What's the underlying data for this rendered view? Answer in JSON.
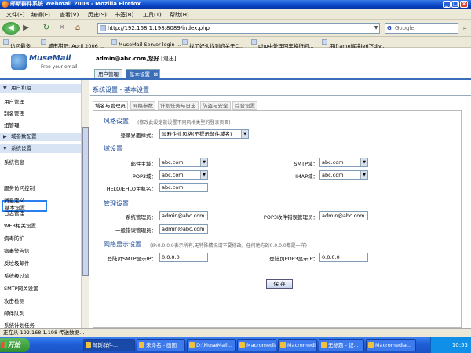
{
  "window": {
    "title": "邮斯群件系统 Webmail 2008 - Mozilla Firefox"
  },
  "menu": [
    "文件(F)",
    "编辑(E)",
    "查看(V)",
    "历史(S)",
    "书签(B)",
    "工具(T)",
    "帮助(H)"
  ],
  "nav": {
    "url": "http://192.168.1.198:8089/index.php",
    "search_placeholder": "Google",
    "search_engine": "G"
  },
  "bookmarks": [
    "访问最多",
    "城市甜阳: April 2006 ...",
    "MuseMail Server login ...",
    "找了好久找到的关于C...",
    "php中处理回车换行问...",
    "用iframe解决ie6下div..."
  ],
  "app": {
    "logo_name": "MuseMail",
    "logo_tag": "Free your email",
    "user": "admin@abc.com,您好",
    "logout": "[退出]",
    "tabs": [
      "用户管理",
      "基本设置"
    ],
    "tab_close": "⊠"
  },
  "sidebar": {
    "sections": [
      "用户和组",
      "域参数配置",
      "系统设置"
    ],
    "group1": [
      "用户管理",
      "别名管理",
      "组管理"
    ],
    "group3": [
      "系统信息",
      "基本设置",
      "服务访问控制",
      "消息定义",
      "日志管理",
      "WEB相关设置",
      "病毒防护",
      "病毒警告信",
      "反垃圾邮件",
      "系统级过滤",
      "SMTP网关设置",
      "攻击检测",
      "邮件队列",
      "系统计划任务"
    ]
  },
  "main": {
    "title": "系统设置 - 基本设置",
    "subtabs": [
      "域名与管理员",
      "网络参数",
      "计划任务与日志",
      "防盗与安全",
      "综合设置"
    ],
    "style_section": "风格设置",
    "style_note": "(修改此设定能设置不同风格类型的登录页面)",
    "login_style_label": "登录界面样式：",
    "login_style_value": "淡雅企业风格(不提示邮件域名)",
    "domain_section": "域设置",
    "main_domain_label": "邮件主域：",
    "main_domain_value": "abc.com",
    "smtp_domain_label": "SMTP域：",
    "smtp_domain_value": "abc.com",
    "pop3_domain_label": "POP3域：",
    "pop3_domain_value": "abc.com",
    "imap_domain_label": "IMAP域：",
    "imap_domain_value": "abc.com",
    "helo_label": "HELO/EHLO主机名：",
    "helo_value": "abc.com",
    "admin_section": "管理设置",
    "sys_admin_label": "系统管理员：",
    "sys_admin_value": "admin@abc.com",
    "pop3_err_label": "POP3收件错误管理员：",
    "pop3_err_value": "admin@abc.com",
    "general_err_label": "一般错误管理员：",
    "general_err_value": "admin@abc.com",
    "net_section": "网络显示设置",
    "net_note": "(IP:0.0.0.0表示所有,无特殊情况请不要修改。任何地方的0.0.0.0都是一样)",
    "smtp_ip_label": "登陆页SMTP显示IP：",
    "smtp_ip_value": "0.0.0.0",
    "pop3_ip_label": "登陆页POP3显示IP：",
    "pop3_ip_value": "0.0.0.0",
    "save_label": "保 存"
  },
  "status": "正在从 192.168.1.198 传送数据...",
  "taskbar": {
    "start": "开始",
    "items": [
      "邮斯群件...",
      "未命名 - 画图",
      "D:\\MuseMail...",
      "Macromedia...",
      "Macromedia...",
      "无标题 - 记...",
      "Macromedia..."
    ],
    "clock": "10:53"
  }
}
